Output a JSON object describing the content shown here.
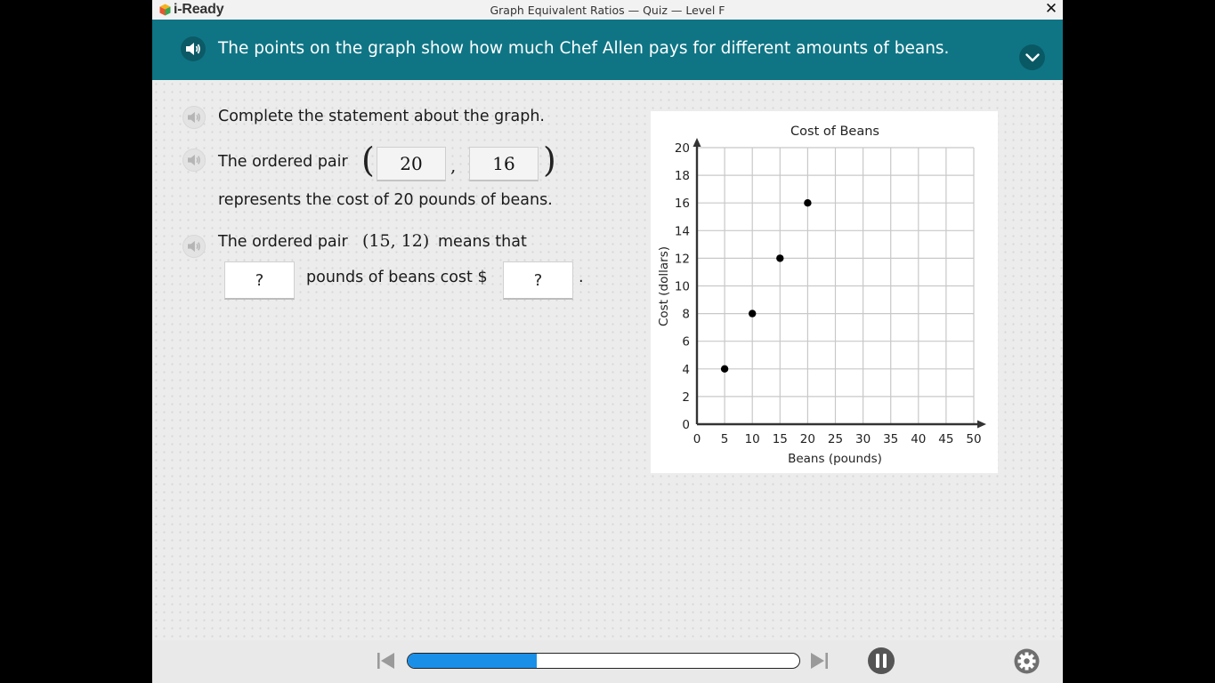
{
  "titlebar": {
    "logo_text": "i-Ready",
    "window_title": "Graph Equivalent Ratios — Quiz — Level F",
    "close_symbol": "✕"
  },
  "prompt": {
    "text": "The points on the graph show how much Chef Allen pays for different amounts of beans.",
    "speaker_icon": "speaker-icon",
    "collapse_icon": "chevron-down-icon"
  },
  "questions": {
    "instruction": "Complete the statement about the graph.",
    "q1": {
      "lead": "The ordered pair",
      "open_paren": "(",
      "x_value": "20",
      "comma": ",",
      "y_value": "16",
      "close_paren": ")",
      "follow": "represents the cost of 20 pounds of beans."
    },
    "q2": {
      "lead": "The ordered pair",
      "pair": "(15, 12)",
      "means": "means that",
      "box1_value": "?",
      "middle": "pounds of beans cost $",
      "box2_value": "?",
      "end": "."
    }
  },
  "chart_data": {
    "type": "scatter",
    "title": "Cost of Beans",
    "xlabel": "Beans (pounds)",
    "ylabel": "Cost (dollars)",
    "xlim": [
      0,
      50
    ],
    "ylim": [
      0,
      20
    ],
    "x_ticks": [
      0,
      5,
      10,
      15,
      20,
      25,
      30,
      35,
      40,
      45,
      50
    ],
    "y_ticks": [
      0,
      2,
      4,
      6,
      8,
      10,
      12,
      14,
      16,
      18,
      20
    ],
    "grid": true,
    "series": [
      {
        "points": [
          [
            5,
            4
          ],
          [
            10,
            8
          ],
          [
            15,
            12
          ],
          [
            20,
            16
          ]
        ]
      }
    ]
  },
  "footer": {
    "progress_fraction": 0.33,
    "prev_icon": "skip-back-icon",
    "next_icon": "skip-forward-icon",
    "pause_icon": "pause-icon",
    "settings_icon": "gear-icon",
    "accent": "#1a8fe8"
  },
  "colors": {
    "prompt_bar": "#0f7585",
    "page_bg": "#ececec"
  }
}
